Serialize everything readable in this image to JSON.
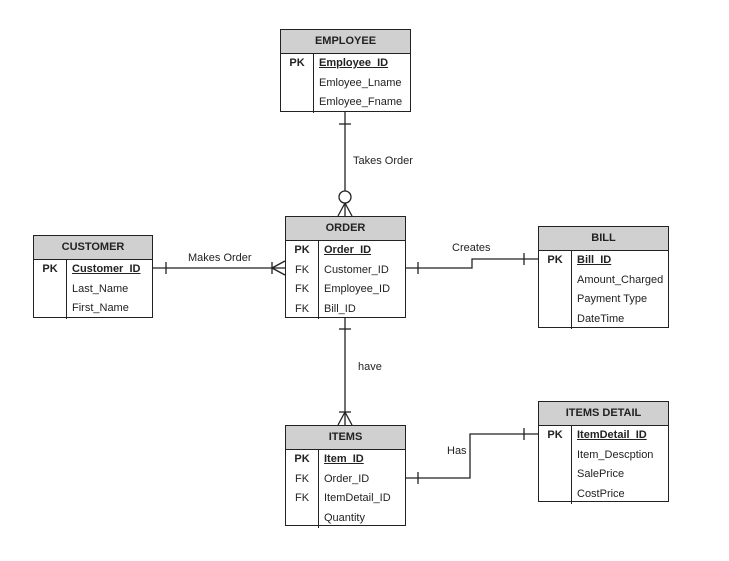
{
  "entities": {
    "employee": {
      "title": "EMPLOYEE",
      "rows": [
        {
          "key": "PK",
          "field": "Employee_ID"
        },
        {
          "key": "",
          "field": "Emloyee_Lname"
        },
        {
          "key": "",
          "field": "Emloyee_Fname"
        }
      ]
    },
    "order": {
      "title": "ORDER",
      "rows": [
        {
          "key": "PK",
          "field": "Order_ID"
        },
        {
          "key": "FK",
          "field": "Customer_ID"
        },
        {
          "key": "FK",
          "field": "Employee_ID"
        },
        {
          "key": "FK",
          "field": "Bill_ID"
        }
      ]
    },
    "customer": {
      "title": "CUSTOMER",
      "rows": [
        {
          "key": "PK",
          "field": "Customer_ID"
        },
        {
          "key": "",
          "field": "Last_Name"
        },
        {
          "key": "",
          "field": "First_Name"
        }
      ]
    },
    "bill": {
      "title": "BILL",
      "rows": [
        {
          "key": "PK",
          "field": "Bill_ID"
        },
        {
          "key": "",
          "field": "Amount_Charged"
        },
        {
          "key": "",
          "field": "Payment Type"
        },
        {
          "key": "",
          "field": "DateTime"
        }
      ]
    },
    "items": {
      "title": "ITEMS",
      "rows": [
        {
          "key": "PK",
          "field": "Item_ID"
        },
        {
          "key": "FK",
          "field": "Order_ID"
        },
        {
          "key": "FK",
          "field": "ItemDetail_ID"
        },
        {
          "key": "",
          "field": "Quantity"
        }
      ]
    },
    "items_detail": {
      "title": "ITEMS DETAIL",
      "rows": [
        {
          "key": "PK",
          "field": "ItemDetail_ID"
        },
        {
          "key": "",
          "field": "Item_Descption"
        },
        {
          "key": "",
          "field": "SalePrice"
        },
        {
          "key": "",
          "field": "CostPrice"
        }
      ]
    }
  },
  "relationships": {
    "takes_order": "Takes Order",
    "makes_order": "Makes Order",
    "creates": "Creates",
    "have": "have",
    "has": "Has"
  }
}
